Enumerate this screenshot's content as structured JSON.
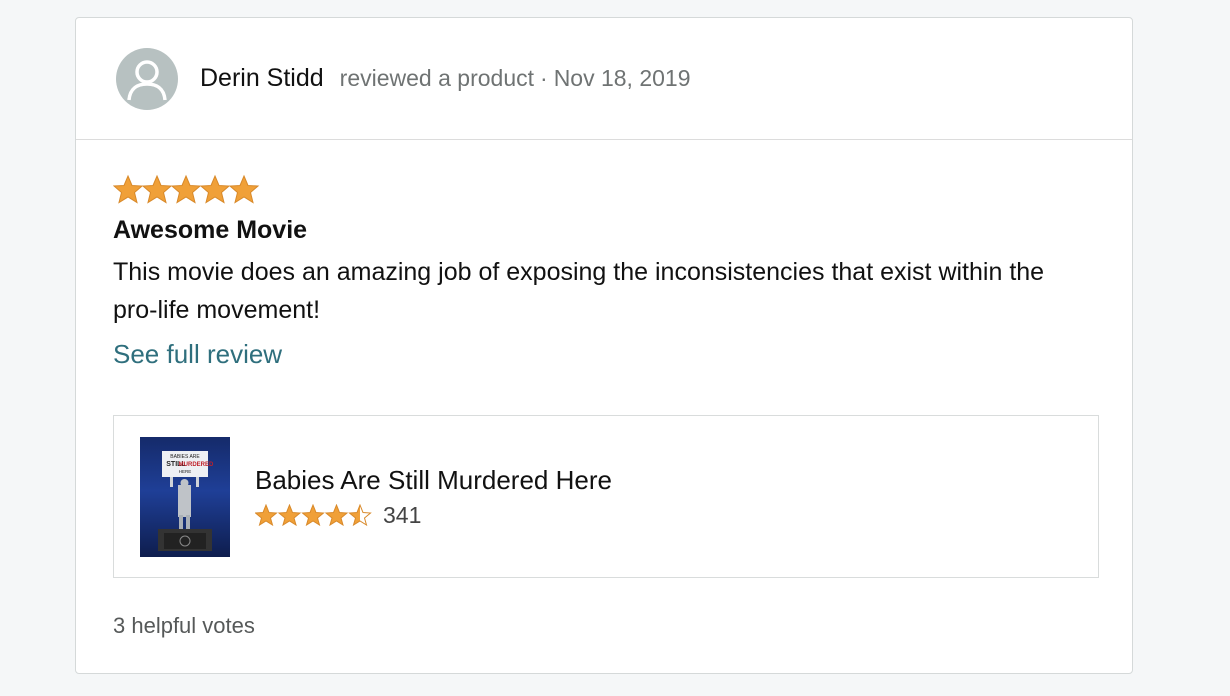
{
  "reviewer": {
    "name": "Derin Stidd",
    "action": "reviewed a product",
    "separator": "·",
    "date": "Nov 18, 2019"
  },
  "review": {
    "rating_stars": 5,
    "title": "Awesome Movie",
    "text": "This movie does an amazing job of exposing the inconsistencies that exist within the pro-life movement!",
    "see_full_label": "See full review"
  },
  "product": {
    "title": "Babies Are Still Murdered Here",
    "rating": 4.5,
    "rating_count": "341",
    "poster_text": [
      "BABIES ARE",
      "STILL",
      "MURDERED",
      "HERE"
    ]
  },
  "helpful_votes": "3 helpful votes",
  "colors": {
    "star": "#f0a038",
    "star_outline": "#d8892a",
    "link": "#2f6f7d",
    "avatar_bg": "#b7c1c1"
  }
}
